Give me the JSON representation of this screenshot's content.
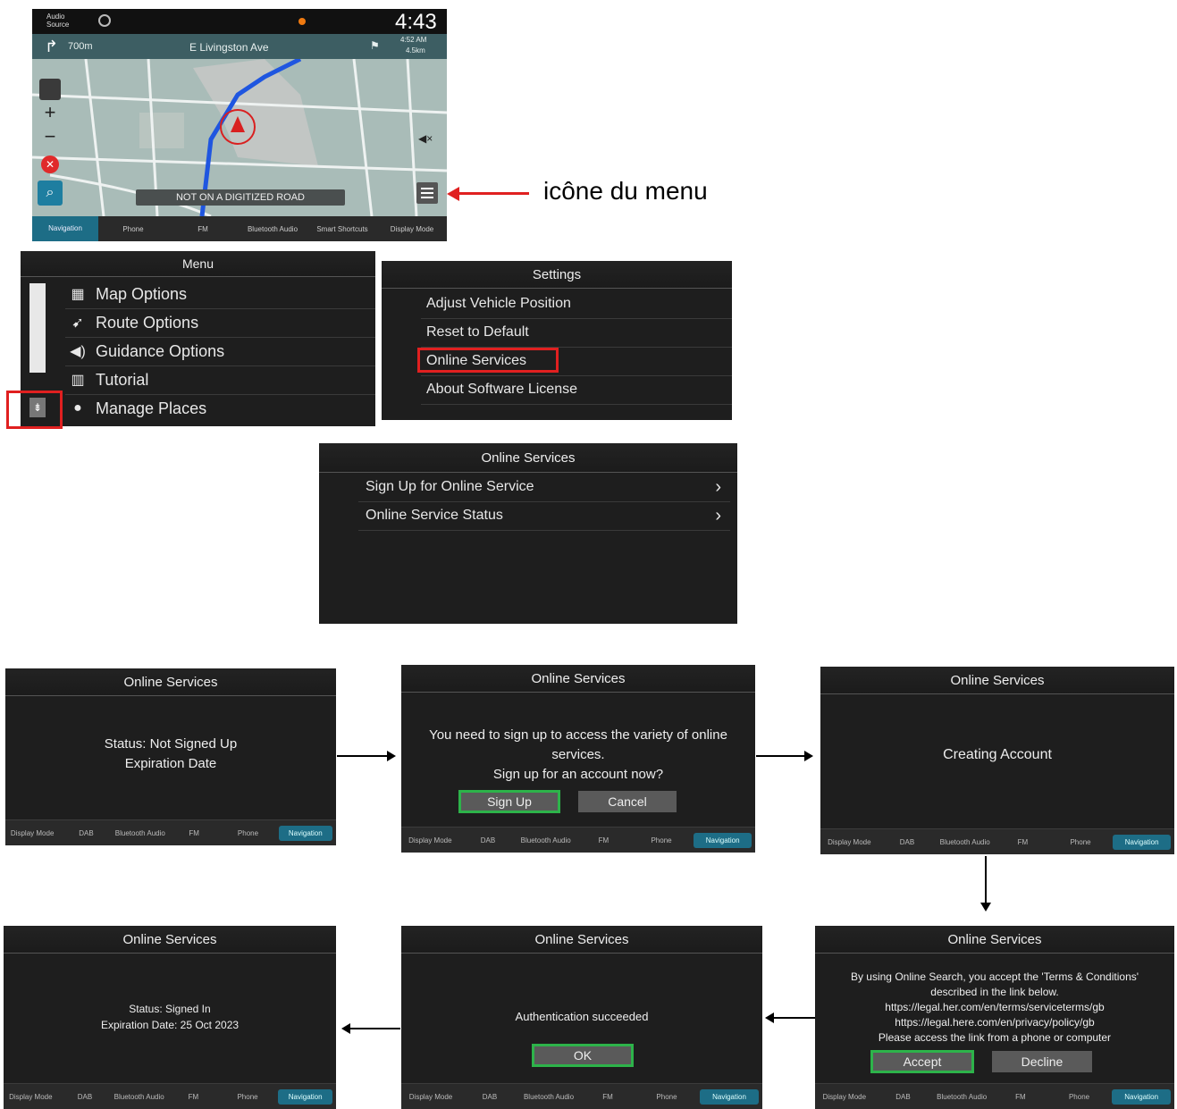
{
  "nav_screen": {
    "audio_source": "Audio Source",
    "clock": "4:43",
    "turn_distance": "700m",
    "street": "E Livingston Ave",
    "eta_time": "4:52 AM",
    "eta_distance": "4.5km",
    "road_banner": "NOT ON A DIGITIZED ROAD",
    "bottom_tabs": [
      "Navigation",
      "Phone",
      "FM",
      "Bluetooth Audio",
      "Smart Shortcuts",
      "Display Mode"
    ]
  },
  "menu_annotation": "icône du menu",
  "menu": {
    "title": "Menu",
    "items": [
      "Map Options",
      "Route Options",
      "Guidance Options",
      "Tutorial",
      "Manage Places"
    ]
  },
  "settings": {
    "title": "Settings",
    "items": [
      "Adjust Vehicle Position",
      "Reset to Default",
      "Online Services",
      "About Software License"
    ]
  },
  "online_services_list": {
    "title": "Online Services",
    "items": [
      "Sign Up for Online Service",
      "Online Service Status"
    ]
  },
  "flow_bar_tabs": [
    "Display Mode",
    "DAB",
    "Bluetooth Audio",
    "FM",
    "Phone",
    "Navigation"
  ],
  "screens": {
    "status_not_signed": {
      "title": "Online Services",
      "line1": "Status: Not Signed Up",
      "line2": "Expiration Date"
    },
    "signup_prompt": {
      "title": "Online Services",
      "line1": "You need to sign up to access the variety of online",
      "line2": "services.",
      "line3": "Sign up for an account now?",
      "ok": "Sign Up",
      "cancel": "Cancel"
    },
    "creating": {
      "title": "Online Services",
      "text": "Creating Account"
    },
    "terms": {
      "title": "Online Services",
      "line1": "By using Online Search, you accept the 'Terms & Conditions'",
      "line2": "described in the link below.",
      "line3": "https://legal.her.com/en/terms/serviceterms/gb",
      "line4": "https://legal.here.com/en/privacy/policy/gb",
      "line5": "Please access the link from a phone or computer",
      "accept": "Accept",
      "decline": "Decline"
    },
    "auth": {
      "title": "Online Services",
      "text": "Authentication succeeded",
      "ok": "OK"
    },
    "signed_in": {
      "title": "Online Services",
      "line1": "Status: Signed In",
      "line2": "Expiration Date:  25 Oct 2023"
    }
  }
}
